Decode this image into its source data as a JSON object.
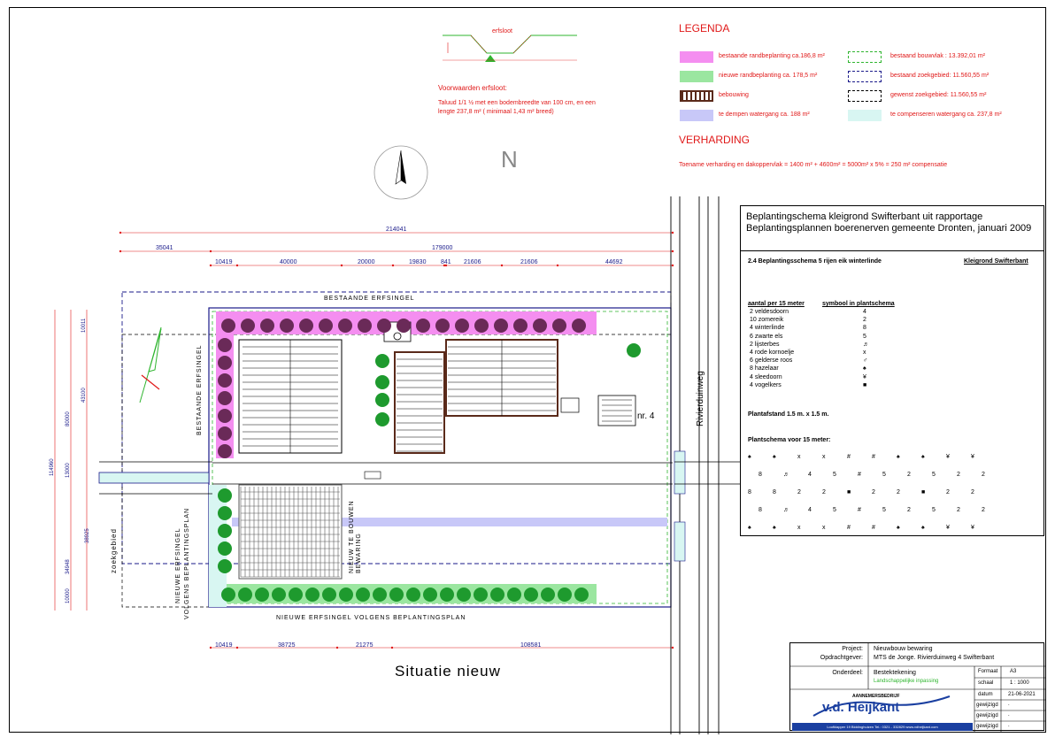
{
  "legend": {
    "title": "LEGENDA",
    "items_left": [
      {
        "label": "bestaande randbeplanting ca.186,8 m²",
        "color": "#f48ef0"
      },
      {
        "label": "nieuwe randbeplanting ca. 178,5 m²",
        "color": "#9be6a0"
      },
      {
        "label": "bebouwing",
        "color": "#5a2a1a"
      },
      {
        "label": "te dempen watergang ca. 188 m²",
        "color": "#c8c8f8"
      }
    ],
    "items_right": [
      {
        "label": "bestaand bouwvlak : 13.392,01 m²",
        "color": "#2fb52f"
      },
      {
        "label": "bestaand zoekgebied: 11.560,55 m²",
        "color": "#1a1a8a"
      },
      {
        "label": "gewenst zoekgebied: 11.560,55 m²",
        "color": "#000000"
      },
      {
        "label": "te compenseren watergang ca. 237,8 m²",
        "color": "#d8f6f2"
      }
    ],
    "verharding_title": "VERHARDING",
    "verharding_text": "Toename verharding en dakoppervlak = 1400 m² + 4600m² = 5000m²  x 5% = 250 m² compensatie"
  },
  "erfsloot": {
    "label": "erfsloot",
    "title": "Voorwaarden erfsloot:",
    "text_line1": "Taluud 1/1  ½ met een bodembreedte van 100 cm, en een",
    "text_line2": "lengte 237,8 m² ( minimaal 1,43 m² breed)"
  },
  "north_label": "N",
  "plan": {
    "dims_top": [
      "214041",
      "179000",
      "35041"
    ],
    "dims_row": [
      "10419",
      "40000",
      "20000",
      "19830",
      "841",
      "21606",
      "21606",
      "44692"
    ],
    "dims_bottom": [
      "10419",
      "38725",
      "21275",
      "108581"
    ],
    "dims_left": [
      "114960",
      "80000",
      "43100",
      "13000",
      "38925",
      "34948",
      "10000",
      "10011"
    ],
    "labels": {
      "bestaande_top": "BESTAANDE ERFSINGEL",
      "bestaande_left": "BESTAANDE ERFSINGEL",
      "nieuwe_bottom": "NIEUWE ERFSINGEL VOLGENS BEPLANTINGSPLAN",
      "nieuwe_left1": "NIEUWE ERFSINGEL",
      "nieuwe_left2": "VOLGENS BEPLANTINGSPLAN",
      "nieuw_te_bouwen1": "NIEUW TE BOUWEN",
      "nieuw_te_bouwen2": "BEWARING",
      "zoekgebied": "zoekgebied",
      "road": "Rivierduinweg",
      "house_nr": "nr. 4"
    }
  },
  "title_main": "Situatie nieuw",
  "beplanting": {
    "header": "Beplantingschema kleigrond Swifterbant uit rapportage Beplantingsplannen boerenerven gemeente Dronten, januari 2009",
    "section": "2.4  Beplantingsschema 5 rijen eik winterlinde",
    "section_right": "Kleigrond Swifterbant",
    "col1": "aantal per 15 meter",
    "col2": "symbool in plantschema",
    "rows": [
      {
        "name": "2 veldesdoorn",
        "sym": "4"
      },
      {
        "name": "10 zomereik",
        "sym": "2"
      },
      {
        "name": "4 winterlinde",
        "sym": "8"
      },
      {
        "name": "6 zwarte els",
        "sym": "5"
      },
      {
        "name": "2 lijsterbes",
        "sym": "♬"
      },
      {
        "name": "4 rode kornoelje",
        "sym": "x"
      },
      {
        "name": "6 gelderse roos",
        "sym": "♂"
      },
      {
        "name": "8 hazelaar",
        "sym": "♠"
      },
      {
        "name": "4 sleedoorn",
        "sym": "¥"
      },
      {
        "name": "4 vogelkers",
        "sym": "■"
      }
    ],
    "plantafstand": "Plantafstand  1.5 m. x 1.5 m.",
    "plantschema_title": "Plantschema voor 15 meter:",
    "schema": [
      [
        "♠",
        "♠",
        "x",
        "x",
        "#",
        "#",
        "♠",
        "♠",
        "¥",
        "¥"
      ],
      [
        "8",
        "♬",
        "4",
        "5",
        "#",
        "5",
        "2",
        "5",
        "2",
        "2"
      ],
      [
        "8",
        "8",
        "2",
        "2",
        "■",
        "2",
        "2",
        "■",
        "2",
        "2"
      ],
      [
        "8",
        "♬",
        "4",
        "5",
        "#",
        "5",
        "2",
        "5",
        "2",
        "2"
      ],
      [
        "♠",
        "♠",
        "x",
        "x",
        "#",
        "#",
        "♠",
        "♠",
        "¥",
        "¥"
      ]
    ]
  },
  "titleblock": {
    "project_label": "Project:",
    "project_value": "Nieuwbouw  bewaring",
    "client_label": "Opdrachtgever:",
    "client_value": "MTS de Jonge. Rivierduinweg 4 Swifterbant",
    "part_label": "Onderdeel:",
    "part_value": "Bestektekening",
    "part_sub": "Landschappelijke inpassing",
    "format_label": "Formaat",
    "format_value": "A3",
    "scale_label": "schaal",
    "scale_value": "1 : 1000",
    "date_label": "datum",
    "date_value": "21-06-2021",
    "rev1": "gewijzigd",
    "rev2": "gewijzigd",
    "rev3": "gewijzigd",
    "rev_val": ".",
    "company_top": "AANNEMERSBEDRIJF",
    "company_name": "v.d. Heijkant",
    "company_address": "Loofklapper 19 Biddinghuizen  Tel.: 0321 - 332829  www.vdheijkant.com"
  }
}
